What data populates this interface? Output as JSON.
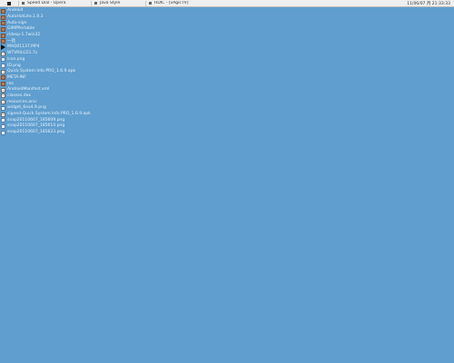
{
  "taskbar": {
    "tasks": [
      {
        "label": "Speed Dial - Opera"
      },
      {
        "label": "Java Style"
      },
      {
        "label": "HDIC - [vAgicTV]"
      }
    ],
    "clock": "11/06/07 月 21:33:33"
  },
  "desktop": {
    "items": [
      {
        "label": "Android",
        "type": "folder"
      },
      {
        "label": "AutoHotLite.1.0.3",
        "type": "folder"
      },
      {
        "label": "Auto-sign",
        "type": "folder"
      },
      {
        "label": "GIMPPortable",
        "type": "folder"
      },
      {
        "label": "ridesp-1.7win32",
        "type": "folder"
      },
      {
        "label": "一括",
        "type": "folder"
      },
      {
        "label": "MAQ01137.MP4",
        "type": "video"
      },
      {
        "label": "WTVRILG51.7z",
        "type": "doc"
      },
      {
        "label": "icon.png",
        "type": "img"
      },
      {
        "label": "ID.png",
        "type": "img"
      },
      {
        "label": "Quick System Info PRO_1.6.9.apk",
        "type": "doc"
      },
      {
        "label": "META-INF",
        "type": "folder"
      },
      {
        "label": "res",
        "type": "folder"
      },
      {
        "label": "AndroidManifest.xml",
        "type": "doc"
      },
      {
        "label": "classes.dex",
        "type": "doc"
      },
      {
        "label": "resources.arsc",
        "type": "doc"
      },
      {
        "label": "widget_6ex4.9.png",
        "type": "img"
      },
      {
        "label": "signed-Quick System Info PRO_1.6.9.apk",
        "type": "doc"
      },
      {
        "label": "snap20110607_185609.png",
        "type": "img"
      },
      {
        "label": "snap20110607_185614.png",
        "type": "img"
      },
      {
        "label": "snap20110607_185623.png",
        "type": "img"
      }
    ]
  }
}
